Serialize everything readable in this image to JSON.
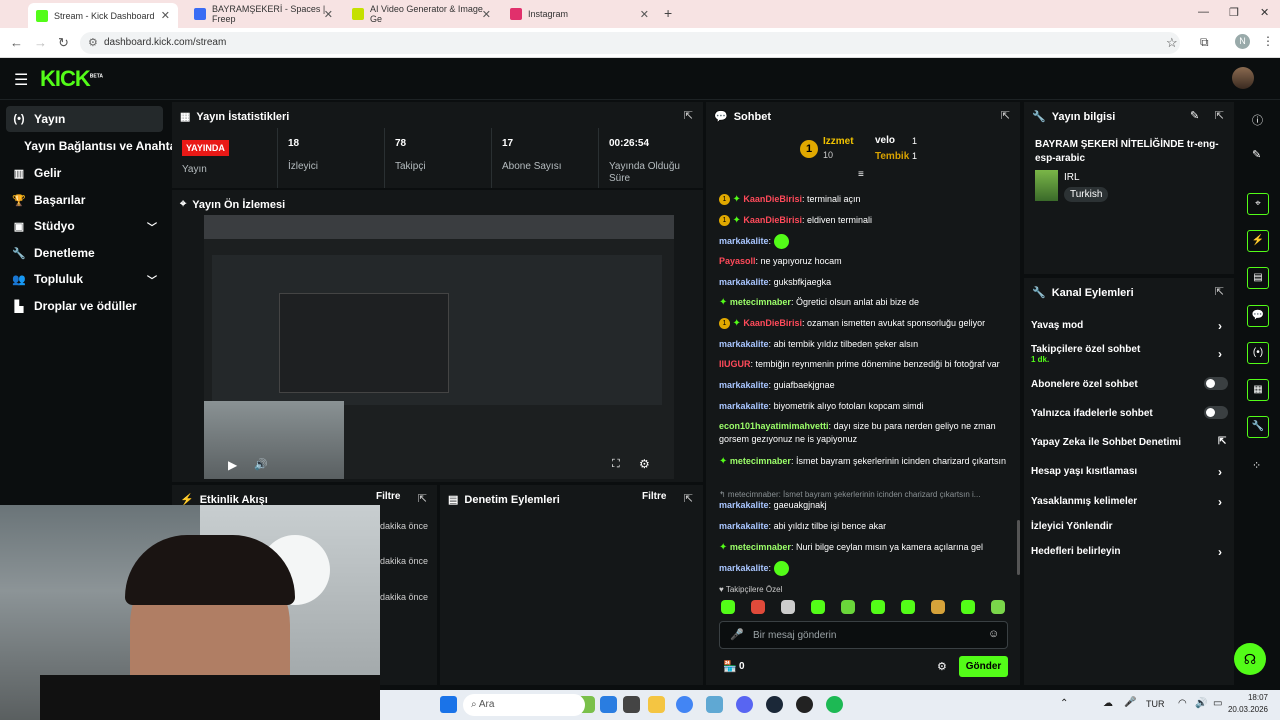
{
  "browser": {
    "tabs": [
      {
        "label": "Stream - Kick Dashboard",
        "color": "#53fc18"
      },
      {
        "label": "BAYRAMŞEKERİ - Spaces | Freep",
        "color": "#3a6cf4"
      },
      {
        "label": "AI Video Generator & Image Ge",
        "color": "#c5e000"
      },
      {
        "label": "Instagram",
        "color": "#e1306c"
      }
    ],
    "new_tab": "+",
    "url": "dashboard.kick.com/stream",
    "profile_initial": "N"
  },
  "header": {
    "logo": "KICK",
    "logo_sup": "BETA"
  },
  "sidebar": {
    "items": [
      {
        "label": "Yayın",
        "icon": "(•)"
      },
      {
        "label": "Yayın Bağlantısı ve Anahtarı",
        "icon": ""
      },
      {
        "label": "Gelir",
        "icon": "▥"
      },
      {
        "label": "Başarılar",
        "icon": "🏆"
      },
      {
        "label": "Stüdyo",
        "icon": "▣"
      },
      {
        "label": "Denetleme",
        "icon": "🔧"
      },
      {
        "label": "Topluluk",
        "icon": "👥"
      },
      {
        "label": "Droplar ve ödüller",
        "icon": "▙"
      }
    ]
  },
  "stats": {
    "title": "Yayın İstatistikleri",
    "live": "YAYINDA",
    "live_label": "Yayın",
    "viewers": "18",
    "viewers_label": "İzleyici",
    "followers": "78",
    "followers_label": "Takipçi",
    "subs": "17",
    "subs_label": "Abone Sayısı",
    "uptime": "00:26:54",
    "uptime_label": "Yayında Olduğu Süre"
  },
  "preview": {
    "title": "Yayın Ön İzlemesi"
  },
  "activity": {
    "title": "Etkinlik Akışı",
    "filter": "Filtre",
    "times": [
      "dakika önce",
      "dakika önce",
      "dakika önce"
    ]
  },
  "moderation": {
    "title": "Denetim Eylemleri",
    "filter": "Filtre"
  },
  "chat": {
    "title": "Sohbet",
    "top": {
      "first": "Izzmet",
      "first_count": "10",
      "second": "velo",
      "second_count": "1",
      "third": "Tembik",
      "third_count": "1",
      "rank": "1"
    },
    "messages": [
      {
        "user": "KaanDieBirisi",
        "text": "terminali açın",
        "color": "red",
        "badge": true
      },
      {
        "user": "KaanDieBirisi",
        "text": "eldiven terminali",
        "color": "red",
        "badge": true
      },
      {
        "user": "markakalite",
        "text": "",
        "color": "blue",
        "emote": true
      },
      {
        "user": "Payasoll",
        "text": "ne yapıyoruz hocam",
        "color": "red"
      },
      {
        "user": "markakalite",
        "text": "guksbfkjaegka",
        "color": "blue"
      },
      {
        "user": "metecimnaber",
        "text": "Ögretici olsun anlat abi bize de",
        "color": "green",
        "diamond": true
      },
      {
        "user": "KaanDieBirisi",
        "text": "ozaman ismetten avukat sponsorluğu geliyor",
        "color": "red",
        "badge": true
      },
      {
        "user": "markakalite",
        "text": "abi tembik yıldız tilbeden şeker alsın",
        "color": "blue"
      },
      {
        "user": "IIUGUR",
        "text": "tembiğin reynmenin prime dönemine benzediği bi fotoğraf var",
        "color": "red"
      },
      {
        "user": "markakalite",
        "text": "guiafbaekjgnae",
        "color": "blue"
      },
      {
        "user": "markakalite",
        "text": "biyometrik alıyo fotoları kopcam simdi",
        "color": "blue"
      },
      {
        "user": "econ101hayatimimahvetti",
        "text": "dayı size bu para nerden geliyo ne zman gorsem gezıyonuz ne is yapiyonuz",
        "color": "green"
      },
      {
        "user": "metecimnaber",
        "text": "İsmet bayram şekerlerinin icinden charizard çıkartsın",
        "color": "green",
        "diamond": true
      },
      {
        "user": "",
        "text": "↰ metecimnaber: İsmet bayram şekerlerinin icinden charizard çıkartsın i...",
        "color": "gray",
        "reply": true
      },
      {
        "user": "markakalite",
        "text": "gaeuakgjnakj",
        "color": "blue"
      },
      {
        "user": "markakalite",
        "text": "abi yıldız tilbe işi bence akar",
        "color": "blue"
      },
      {
        "user": "metecimnaber",
        "text": "Nuri bilge ceylan mısın ya kamera açılarına gel",
        "color": "green",
        "diamond": true
      },
      {
        "user": "markakalite",
        "text": "",
        "color": "blue",
        "emote": true
      }
    ],
    "followers_only": "Takipçilere Özel",
    "placeholder": "Bir mesaj gönderin",
    "count": "0",
    "send": "Gönder"
  },
  "stream_info": {
    "title": "Yayın bilgisi",
    "stream_title": "BAYRAM ŞEKERİ NİTELİĞİNDE tr-eng-esp-arabic",
    "category": "IRL",
    "tag": "Turkish"
  },
  "channel_actions": {
    "title": "Kanal Eylemleri",
    "items": [
      {
        "label": "Yavaş mod",
        "control": "arrow"
      },
      {
        "label": "Takipçilere özel sohbet",
        "sub": "1 dk.",
        "control": "arrow"
      },
      {
        "label": "Abonelere özel sohbet",
        "control": "toggle"
      },
      {
        "label": "Yalnızca ifadelerle sohbet",
        "control": "toggle"
      },
      {
        "label": "Yapay Zeka ile Sohbet Denetimi",
        "control": "external"
      },
      {
        "label": "Hesap yaşı kısıtlaması",
        "control": "arrow"
      },
      {
        "label": "Yasaklanmış kelimeler",
        "control": "arrow"
      },
      {
        "label": "İzleyici Yönlendir",
        "control": "none"
      },
      {
        "label": "Hedefleri belirleyin",
        "control": "arrow"
      }
    ]
  },
  "taskbar": {
    "search": "Ara",
    "lang": "TUR",
    "time": "18:07",
    "date": "20.03.2026"
  }
}
